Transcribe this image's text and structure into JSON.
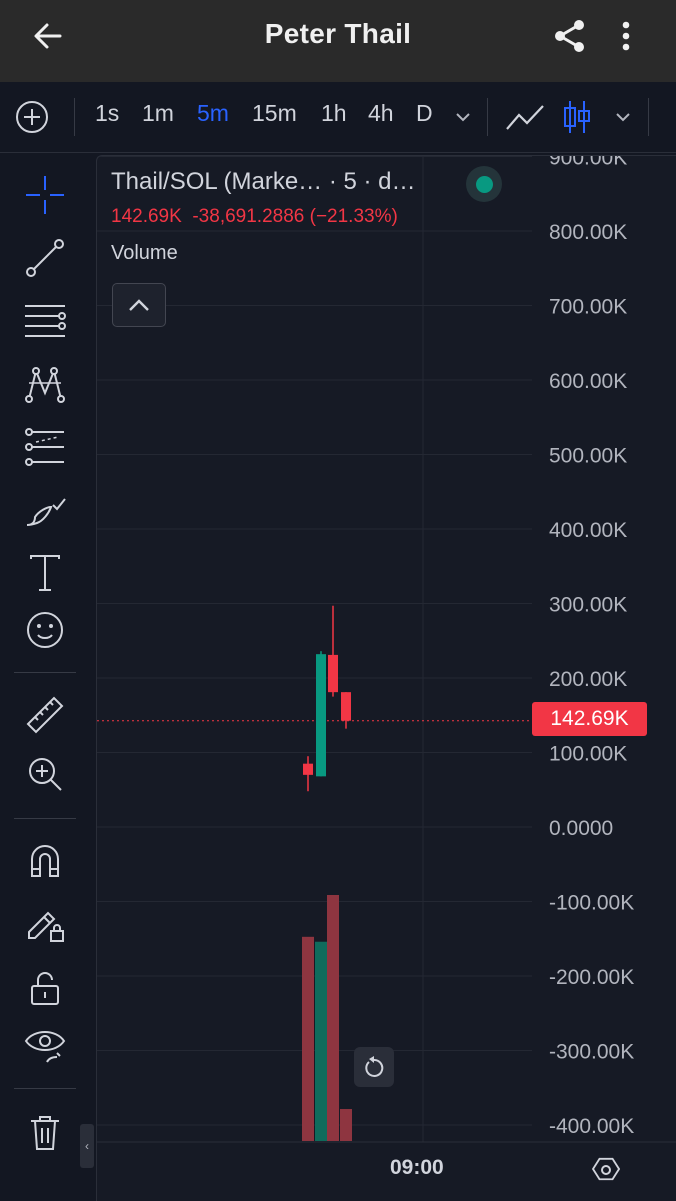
{
  "header": {
    "title": "Peter Thail",
    "back_icon": "arrow-left-icon",
    "share_icon": "share-icon",
    "menu_icon": "more-vertical-icon"
  },
  "toolbar": {
    "add_icon": "plus-circle-icon",
    "timeframes": [
      "1s",
      "1m",
      "5m",
      "15m",
      "1h",
      "4h",
      "D"
    ],
    "active_timeframe": "5m",
    "chart_types": [
      "line-chart-icon",
      "candlestick-icon"
    ]
  },
  "sidebar": {
    "tools": [
      "crosshair-icon",
      "trend-line-icon",
      "fib-lines-icon",
      "pattern-icon",
      "forecast-icon",
      "brush-icon",
      "text-icon",
      "emoji-icon",
      "ruler-icon",
      "zoom-in-icon",
      "magnet-icon",
      "lock-drawing-icon",
      "unlock-icon",
      "eye-icon",
      "trash-icon"
    ],
    "collapse_label": "‹"
  },
  "legend": {
    "title": "Thail/SOL (Marke… · 5 · d…",
    "last_price": "142.69K",
    "change": "-38,691.2886 (−21.33%)",
    "volume_label": "Volume",
    "status": "market-open"
  },
  "price_tag": "142.69K",
  "time_label": "09:00",
  "colors": {
    "up": "#089981",
    "down": "#f23645",
    "accent": "#2962ff",
    "background": "#161a25"
  },
  "chart_data": {
    "type": "candlestick",
    "y_axis_labels": [
      "900.00K",
      "800.00K",
      "700.00K",
      "600.00K",
      "500.00K",
      "400.00K",
      "300.00K",
      "200.00K",
      "100.00K",
      "0.0000",
      "-100.00K",
      "-200.00K",
      "-300.00K",
      "-400.00K"
    ],
    "y_axis_values": [
      900000,
      800000,
      700000,
      600000,
      500000,
      400000,
      300000,
      200000,
      100000,
      0,
      -100000,
      -200000,
      -300000,
      -400000
    ],
    "x_axis_labels": [
      "09:00"
    ],
    "ylim": [
      -440000,
      990000
    ],
    "current_price": 142690,
    "candles": [
      {
        "open": 70000,
        "close": 85000,
        "high": 95000,
        "low": 48000,
        "dir": "down"
      },
      {
        "open": 68000,
        "close": 232000,
        "high": 236000,
        "low": 68000,
        "dir": "up"
      },
      {
        "open": 231000,
        "close": 181000,
        "high": 297000,
        "low": 175000,
        "dir": "down"
      },
      {
        "open": 181000,
        "close": 142690,
        "high": 181000,
        "low": 132000,
        "dir": "down"
      }
    ],
    "volume": [
      {
        "value": 0.83,
        "dir": "down"
      },
      {
        "value": 0.81,
        "dir": "up"
      },
      {
        "value": 1.0,
        "dir": "down"
      },
      {
        "value": 0.13,
        "dir": "down"
      }
    ]
  }
}
